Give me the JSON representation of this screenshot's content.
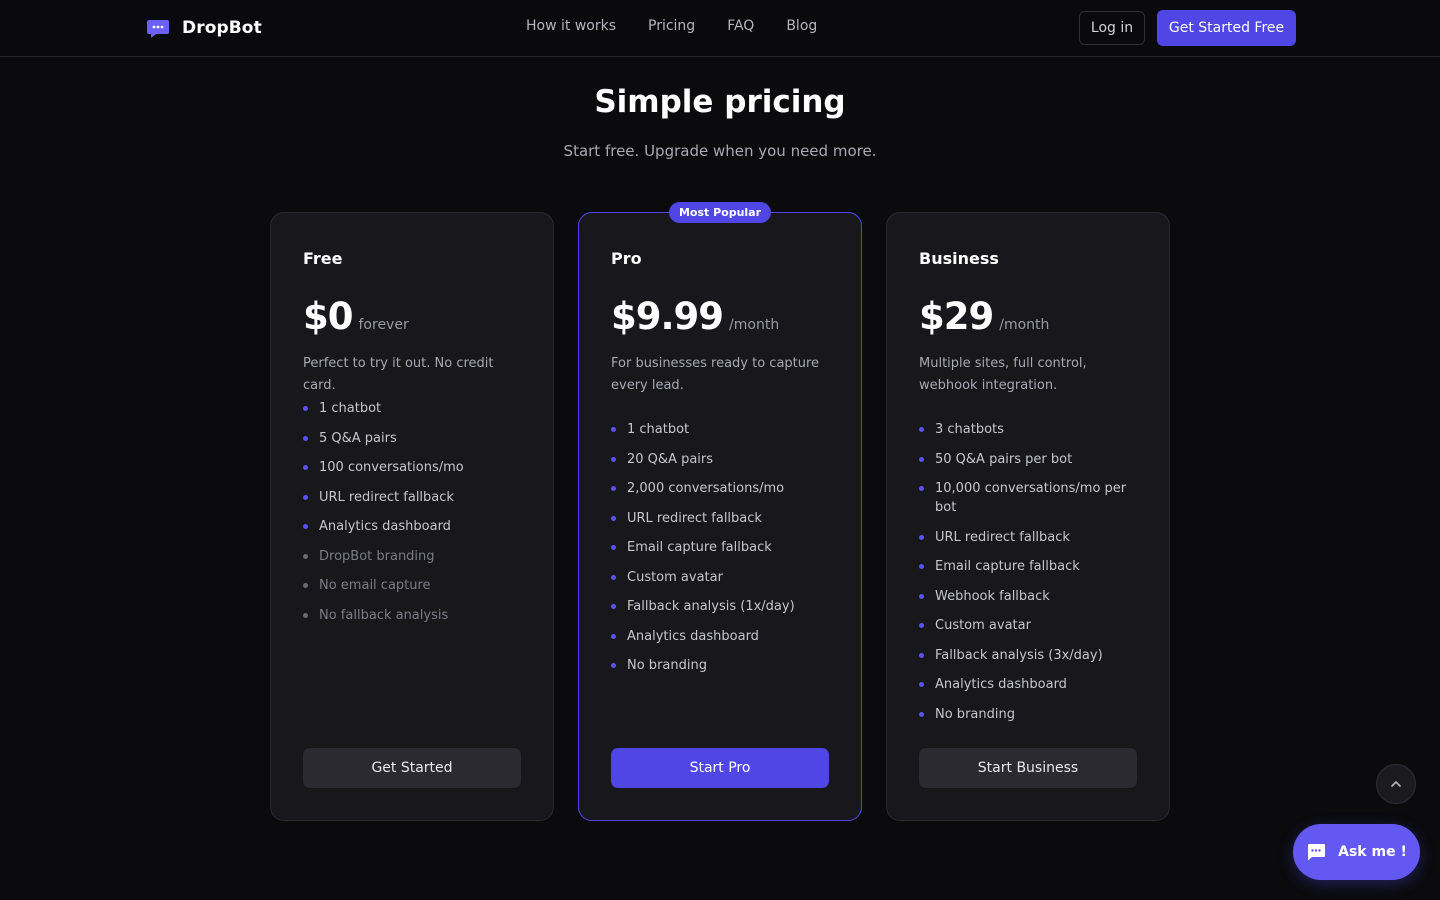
{
  "nav": {
    "brand": "DropBot",
    "links": [
      "How it works",
      "Pricing",
      "FAQ",
      "Blog"
    ],
    "login_label": "Log in",
    "cta_label": "Get Started Free"
  },
  "hero": {
    "title": "Simple pricing",
    "subtitle": "Start free. Upgrade when you need more."
  },
  "plans": [
    {
      "name": "Free",
      "price": "$0",
      "period": "forever",
      "description": "Perfect to try it out. No credit card.",
      "features": [
        {
          "text": "1 chatbot",
          "enabled": true
        },
        {
          "text": "5 Q&A pairs",
          "enabled": true
        },
        {
          "text": "100 conversations/mo",
          "enabled": true
        },
        {
          "text": "URL redirect fallback",
          "enabled": true
        },
        {
          "text": "Analytics dashboard",
          "enabled": true
        },
        {
          "text": "DropBot branding",
          "enabled": false
        },
        {
          "text": "No email capture",
          "enabled": false
        },
        {
          "text": "No fallback analysis",
          "enabled": false
        }
      ],
      "button": "Get Started"
    },
    {
      "name": "Pro",
      "badge": "Most Popular",
      "price": "$9.99",
      "period": "/month",
      "description": "For businesses ready to capture every lead.",
      "features": [
        {
          "text": "1 chatbot",
          "enabled": true
        },
        {
          "text": "20 Q&A pairs",
          "enabled": true
        },
        {
          "text": "2,000 conversations/mo",
          "enabled": true
        },
        {
          "text": "URL redirect fallback",
          "enabled": true
        },
        {
          "text": "Email capture fallback",
          "enabled": true
        },
        {
          "text": "Custom avatar",
          "enabled": true
        },
        {
          "text": "Fallback analysis (1x/day)",
          "enabled": true
        },
        {
          "text": "Analytics dashboard",
          "enabled": true
        },
        {
          "text": "No branding",
          "enabled": true
        }
      ],
      "button": "Start Pro"
    },
    {
      "name": "Business",
      "price": "$29",
      "period": "/month",
      "description": "Multiple sites, full control, webhook integration.",
      "features": [
        {
          "text": "3 chatbots",
          "enabled": true
        },
        {
          "text": "50 Q&A pairs per bot",
          "enabled": true
        },
        {
          "text": "10,000 conversations/mo per bot",
          "enabled": true
        },
        {
          "text": "URL redirect fallback",
          "enabled": true
        },
        {
          "text": "Email capture fallback",
          "enabled": true
        },
        {
          "text": "Webhook fallback",
          "enabled": true
        },
        {
          "text": "Custom avatar",
          "enabled": true
        },
        {
          "text": "Fallback analysis (3x/day)",
          "enabled": true
        },
        {
          "text": "Analytics dashboard",
          "enabled": true
        },
        {
          "text": "No branding",
          "enabled": true
        }
      ],
      "button": "Start Business"
    }
  ],
  "widgets": {
    "scroll_top_icon": "chevron-up-icon",
    "ask_label": "Ask me !",
    "ask_icon": "chat-bubble-icon"
  },
  "colors": {
    "accent": "#5046e5",
    "background": "#0b0b0e",
    "card": "#17171c"
  }
}
